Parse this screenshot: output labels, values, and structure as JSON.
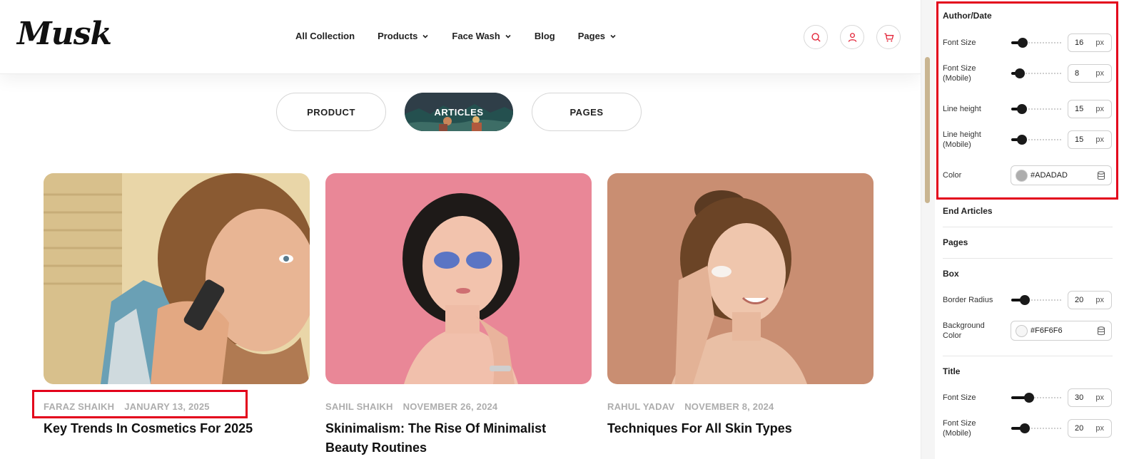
{
  "header": {
    "logo": "Musk",
    "nav": [
      {
        "label": "All Collection",
        "has_dropdown": false
      },
      {
        "label": "Products",
        "has_dropdown": true
      },
      {
        "label": "Face Wash",
        "has_dropdown": true
      },
      {
        "label": "Blog",
        "has_dropdown": false
      },
      {
        "label": "Pages",
        "has_dropdown": true
      }
    ],
    "icons": [
      "search-icon",
      "user-icon",
      "cart-icon"
    ],
    "icon_color": "#e3263a"
  },
  "tabs": [
    {
      "label": "PRODUCT",
      "active": false
    },
    {
      "label": "ARTICLES",
      "active": true
    },
    {
      "label": "PAGES",
      "active": false
    }
  ],
  "articles": [
    {
      "author": "FARAZ SHAIKH",
      "date": "JANUARY 13, 2025",
      "title": "Key Trends In Cosmetics For 2025"
    },
    {
      "author": "SAHIL SHAIKH",
      "date": "NOVEMBER 26, 2024",
      "title": "Skinimalism: The Rise Of Minimalist Beauty Routines"
    },
    {
      "author": "RAHUL YADAV",
      "date": "NOVEMBER 8, 2024",
      "title": "Techniques For All Skin Types"
    }
  ],
  "settings": {
    "author_date": {
      "heading": "Author/Date",
      "font_size": {
        "label": "Font Size",
        "value": "16",
        "unit": "px"
      },
      "font_size_mobile": {
        "label": "Font Size (Mobile)",
        "value": "8",
        "unit": "px"
      },
      "line_height": {
        "label": "Line height",
        "value": "15",
        "unit": "px"
      },
      "line_height_mobile": {
        "label": "Line height (Mobile)",
        "value": "15",
        "unit": "px"
      },
      "color": {
        "label": "Color",
        "value": "#ADADAD"
      }
    },
    "end_articles": {
      "heading": "End Articles"
    },
    "pages": {
      "heading": "Pages"
    },
    "box": {
      "heading": "Box",
      "border_radius": {
        "label": "Border Radius",
        "value": "20",
        "unit": "px"
      },
      "background_color": {
        "label": "Background Color",
        "value": "#F6F6F6"
      }
    },
    "title": {
      "heading": "Title",
      "font_size": {
        "label": "Font Size",
        "value": "30",
        "unit": "px"
      },
      "font_size_mobile": {
        "label": "Font Size (Mobile)",
        "value": "20",
        "unit": "px"
      }
    }
  },
  "colors": {
    "highlight": "#e3001b",
    "meta_text": "#adadad",
    "scroll_thumb": "#c9b591"
  }
}
